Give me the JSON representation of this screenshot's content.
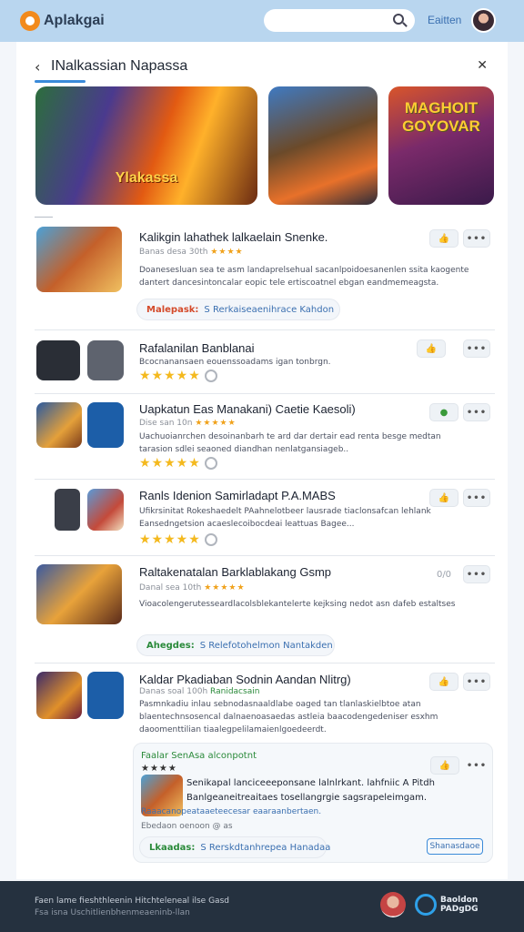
{
  "topbar": {
    "app_name": "Aplakgai",
    "search_placeholder": "",
    "link_label": "Eaitten"
  },
  "header": {
    "title": "INalkassian Napassa",
    "close_glyph": "✕",
    "back_glyph": "‹"
  },
  "banners": [
    {
      "caption": "Ylakassa",
      "top": ""
    },
    {
      "caption": "",
      "top": ""
    },
    {
      "caption": "",
      "top": "MAGHOIT GOYOVAR"
    }
  ],
  "items": [
    {
      "title": "Kalikgin lahathek lalkaelain Snenke.",
      "meta": "Banas desa 30th",
      "meta_stars": "★★★★",
      "desc": "Doanesesluan sea te asm landaprelsehual sacanlpoidoesanenlen ssita kaogente dantert dancesintoncalar eopic tele ertiscoatnel ebgan eandmemeagsta.",
      "chip_label": "Malepask:",
      "chip_value": "S Rerkaiseaenihrace Kahdon",
      "like": "👍",
      "more": "•••"
    },
    {
      "title": "Rafalanilan Banblanai",
      "desc": "Bcocnanansaen eouenssoadams igan tonbrgn.",
      "stars": "★★★★★",
      "like": "👍",
      "more": "•••"
    },
    {
      "title": "Uapkatun Eas Manakani) Caetie Kaesoli)",
      "meta": "Dise san 10n",
      "meta_stars": "★★★★★",
      "desc": "Uachuoianrchen desoinanbarh te ard dar dertair ead renta besge medtan tarasion sdlei seaoned diandhan nenlatgansiageb..",
      "stars": "★★★★★",
      "like": "●",
      "more": "•••"
    },
    {
      "title": "Ranls Idenion Samirladapt P.A.MABS",
      "desc": "Ufikrsinitat Rokeshaedelt PAahnelotbeer lausrade tiaclonsafcan lehlank Eansedngetsion acaeslecoibocdeai leattuas Bagee...",
      "stars": "★★★★★",
      "like": "👍",
      "more": "•••"
    },
    {
      "title": "Raltakenatalan Barklablakang Gsmp",
      "meta": "Danal sea 10th",
      "meta_stars": "★★★★★",
      "desc": "Vioacolengerutesseardlacolsblekantelerte kejksing nedot asn dafeb estaltses",
      "chip_label": "Ahegdes:",
      "chip_value": "S Relefotohelmon Nantakden",
      "like": "0/0",
      "more": "•••"
    },
    {
      "title": "Kaldar Pkadiaban Sodnin Aandan Nlitrg)",
      "meta": "Danas soal 100h",
      "meta_green": "Ranidacsain",
      "desc": "Pasmnkadiu inlau sebnodasnaaldlabe oaged tan tlanlaskielbtoe atan blaentechnsosencal dalnaenoasaedas astleia baacodengedeniser esxhm daoomenttilian tiaalegpelilamaienlgoedeerdt.",
      "like": "👍",
      "more": "•••"
    }
  ],
  "nested": {
    "head": "Faalar SenAsa alconpotnt",
    "stars": "★★★★",
    "title": "Senikapal lanciceeeponsane lalnlrkant. lahfniic A Pitdh",
    "sub": "Banlgeaneitreaitaes tosellangrgie sagsrapeleimgam.",
    "meta": "Raaacanopeataaeteecesar eaaraanbertaen.",
    "meta2": "Ebedaon oenoon @ as",
    "chip_label": "Lkaadas:",
    "chip_value": "S Rerskdtanhrepea Hanadaa",
    "like": "👍",
    "more": "•••",
    "button": "Shanasdaoe"
  },
  "footer": {
    "line1": "Faen lame fieshthleenin Hitchteleneal ilse Gasd",
    "line2": "Fsa isna Uschitlienbhenmeaeninb-llan",
    "logo_text": "Baoldon PADgDG"
  }
}
